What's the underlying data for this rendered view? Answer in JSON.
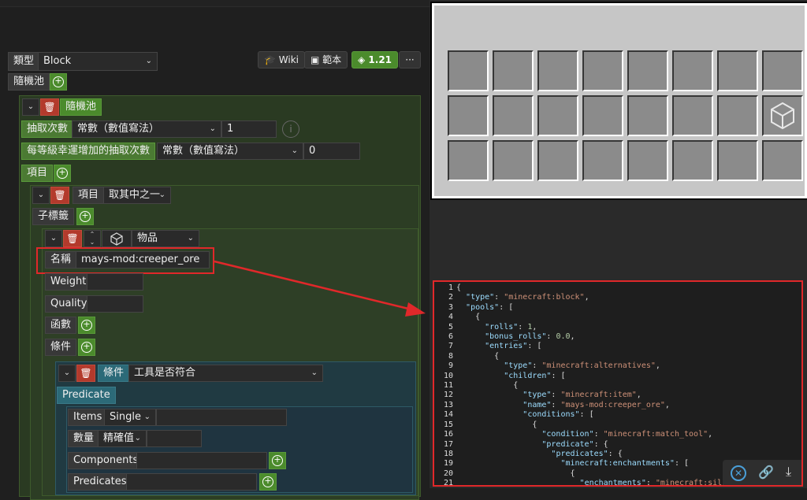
{
  "header": {
    "type_label": "類型",
    "type_value": "Block",
    "wiki_label": "Wiki",
    "examples_label": "範本",
    "version_label": "1.21",
    "more_label": "···"
  },
  "pools": {
    "label": "隨機池",
    "pool_title": "隨機池",
    "rolls_label": "抽取次數",
    "rolls_mode": "常數（數值寫法）",
    "rolls_value": "1",
    "bonus_label": "每等級幸運增加的抽取次數",
    "bonus_mode": "常數（數值寫法）",
    "bonus_value": "0",
    "entries_label": "項目",
    "entry_title": "項目",
    "entry_type": "取其中之一",
    "children_label": "子標籤",
    "child_type": "物品",
    "name_label": "名稱",
    "name_value": "mays-mod:creeper_ore",
    "weight_label": "Weight",
    "quality_label": "Quality",
    "functions_label": "函數",
    "conditions_label": "條件",
    "condition_title": "條件",
    "condition_type": "工具是否符合",
    "predicate_label": "Predicate",
    "items_label": "Items",
    "items_value": "Single",
    "count_label": "數量",
    "count_value": "精確值",
    "components_label": "Components",
    "predicates_label": "Predicates"
  },
  "code_lines": [
    {
      "n": "1",
      "html": "<span class='p'>{</span>"
    },
    {
      "n": "2",
      "html": "  <span class='k'>\"type\"</span><span class='p'>: </span><span class='s'>\"minecraft:block\"</span><span class='p'>,</span>"
    },
    {
      "n": "3",
      "html": "  <span class='k'>\"pools\"</span><span class='p'>: [</span>"
    },
    {
      "n": "4",
      "html": "    <span class='p'>{</span>"
    },
    {
      "n": "5",
      "html": "      <span class='k'>\"rolls\"</span><span class='p'>: </span><span class='n'>1</span><span class='p'>,</span>"
    },
    {
      "n": "6",
      "html": "      <span class='k'>\"bonus_rolls\"</span><span class='p'>: </span><span class='n'>0.0</span><span class='p'>,</span>"
    },
    {
      "n": "7",
      "html": "      <span class='k'>\"entries\"</span><span class='p'>: [</span>"
    },
    {
      "n": "8",
      "html": "        <span class='p'>{</span>"
    },
    {
      "n": "9",
      "html": "          <span class='k'>\"type\"</span><span class='p'>: </span><span class='s'>\"minecraft:alternatives\"</span><span class='p'>,</span>"
    },
    {
      "n": "10",
      "html": "          <span class='k'>\"children\"</span><span class='p'>: [</span>"
    },
    {
      "n": "11",
      "html": "            <span class='p'>{</span>"
    },
    {
      "n": "12",
      "html": "              <span class='k'>\"type\"</span><span class='p'>: </span><span class='s'>\"minecraft:item\"</span><span class='p'>,</span>"
    },
    {
      "n": "13",
      "html": "              <span class='k'>\"name\"</span><span class='p'>: </span><span class='s'>\"mays-mod:creeper_ore\"</span><span class='p'>,</span>"
    },
    {
      "n": "14",
      "html": "              <span class='k'>\"conditions\"</span><span class='p'>: [</span>"
    },
    {
      "n": "15",
      "html": "                <span class='p'>{</span>"
    },
    {
      "n": "16",
      "html": "                  <span class='k'>\"condition\"</span><span class='p'>: </span><span class='s'>\"minecraft:match_tool\"</span><span class='p'>,</span>"
    },
    {
      "n": "17",
      "html": "                  <span class='k'>\"predicate\"</span><span class='p'>: {</span>"
    },
    {
      "n": "18",
      "html": "                    <span class='k'>\"predicates\"</span><span class='p'>: {</span>"
    },
    {
      "n": "19",
      "html": "                      <span class='k'>\"minecraft:enchantments\"</span><span class='p'>: [</span>"
    },
    {
      "n": "20",
      "html": "                        <span class='p'>{</span>"
    },
    {
      "n": "21",
      "html": "                          <span class='k'>\"enchantments\"</span><span class='p'>: </span><span class='s'>\"minecraft:silk_touc</span>"
    }
  ],
  "colors": {
    "accent_green": "#4b8b2c",
    "delete_red": "#b33a2c",
    "highlight_red": "#e0282a"
  },
  "icons": {
    "wiki": "graduation-cap-icon",
    "examples": "archive-icon",
    "version": "tag-icon",
    "cube": "cube-icon",
    "info": "info-icon",
    "close": "close-circle-icon",
    "link": "link-icon",
    "download": "download-icon"
  }
}
